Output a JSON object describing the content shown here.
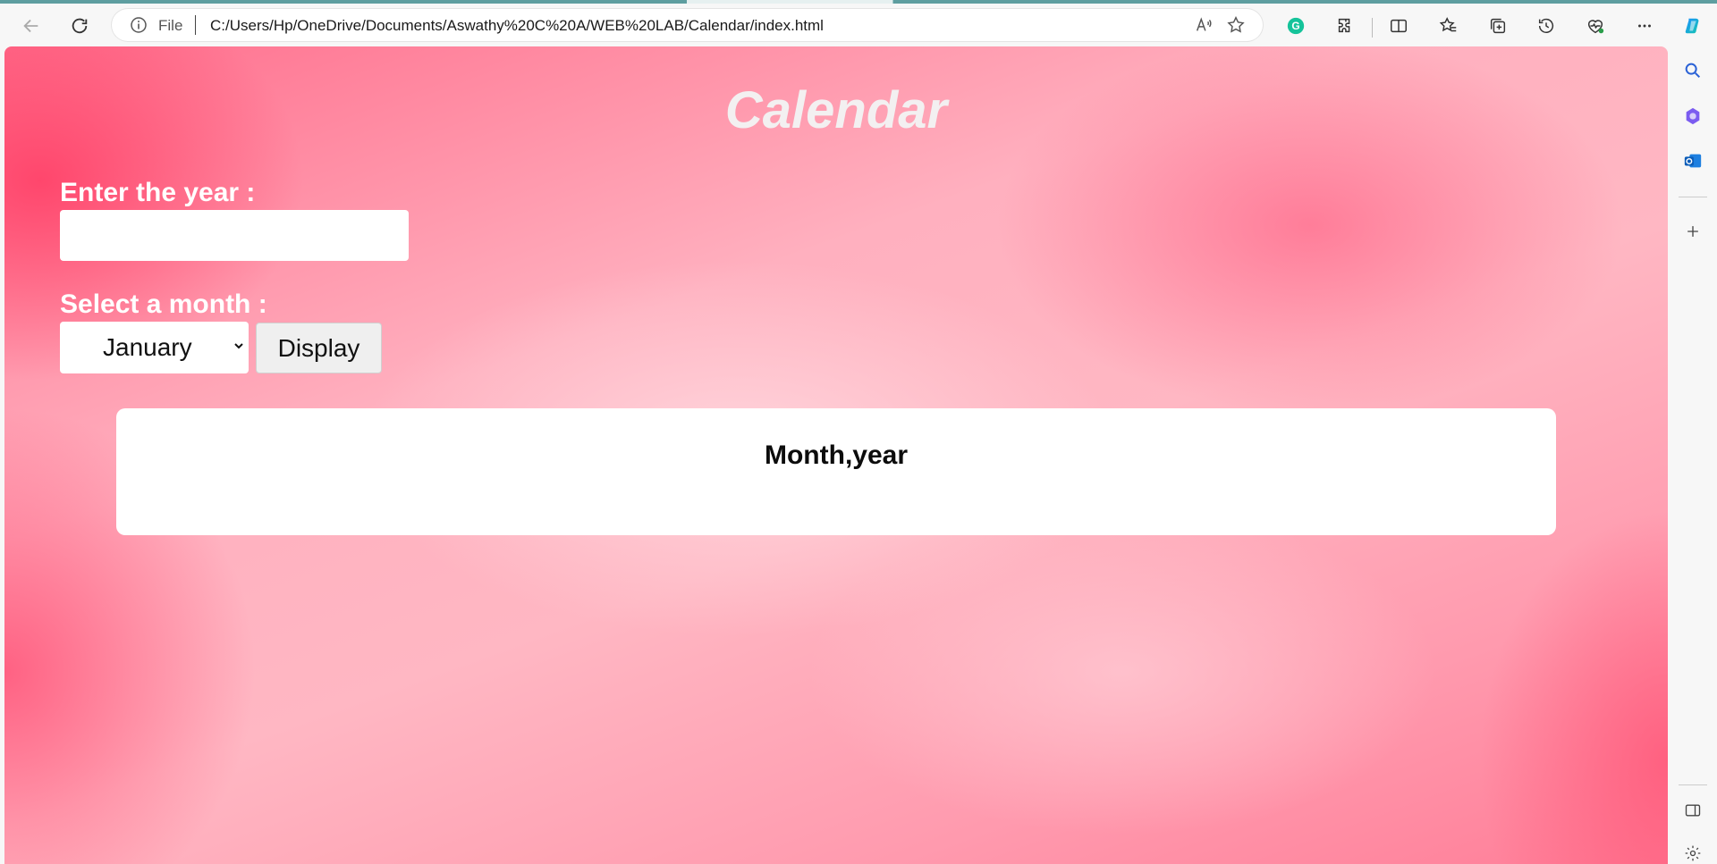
{
  "browser": {
    "address_scheme": "File",
    "url": "C:/Users/Hp/OneDrive/Documents/Aswathy%20C%20A/WEB%20LAB/Calendar/index.html"
  },
  "page": {
    "title": "Calendar",
    "year_label": "Enter the year :",
    "year_value": "",
    "month_label": "Select a month :",
    "month_selected": "January",
    "display_button": "Display",
    "calendar_heading": "Month,year"
  },
  "colors": {
    "background_accent": "#ff6f8d",
    "panel": "#ffffff",
    "title": "#f3f0f1"
  },
  "icons": {
    "toolbar": [
      "back-icon",
      "refresh-icon",
      "info-icon",
      "read-aloud-icon",
      "favorite-star-icon",
      "grammarly-icon",
      "extensions-icon",
      "split-screen-icon",
      "favorites-icon",
      "collections-icon",
      "history-icon",
      "browser-essentials-icon",
      "more-icon",
      "copilot-icon"
    ],
    "sidebar": [
      "search-icon",
      "copilot-app-icon",
      "outlook-icon",
      "add-icon",
      "sidebar-toggle-icon",
      "settings-icon"
    ]
  }
}
